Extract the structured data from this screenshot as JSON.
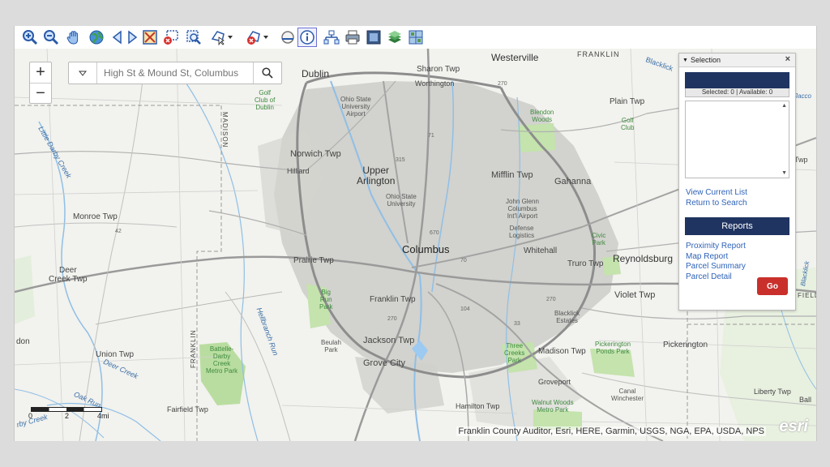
{
  "toolbar": {
    "tools": [
      "zoom-in-icon",
      "zoom-out-icon",
      "pan-icon",
      "full-extent-icon",
      "previous-extent-icon",
      "next-extent-icon",
      "zoom-to-selection-icon",
      "clear-selection-icon",
      "zoom-box-icon",
      "select-dropdown-icon",
      "clear-graphics-dropdown-icon",
      "measure-icon",
      "identify-icon",
      "print-layout-icon",
      "print-icon",
      "overview-icon",
      "layers-icon",
      "basemap-icon"
    ],
    "active_tool": "identify-icon"
  },
  "map": {
    "zoom_in": "+",
    "zoom_out": "−",
    "search_value": "",
    "search_placeholder": "High St & Mound St, Columbus",
    "attribution": "Franklin County Auditor, Esri, HERE, Garmin, USGS, NGA, EPA, USDA, NPS",
    "esri_logo": "esri",
    "scale": {
      "l0": "0",
      "l1": "2",
      "l2": "4mi"
    },
    "labels": {
      "westerville": "Westerville",
      "franklin_n": "FRANKLIN",
      "blacklick_n": "Blacklick",
      "sharon": "Sharon Twp",
      "worthington": "Worthington",
      "dublin": "Dublin",
      "osu_airport": "Ohio State\nUniversity\nAirport",
      "golf_dublin": "Golf\nClub of\nDublin",
      "blendon": "Blendon\nWoods",
      "plain": "Plain Twp",
      "golf_club": "Golf\nClub",
      "norwich": "Norwich Twp",
      "hilliard": "Hilliard",
      "upper_arlington": "Upper\nArlington",
      "mifflin": "Mifflin Twp",
      "gahanna": "Gahanna",
      "osu": "Ohio State\nUniversity",
      "jglenn": "John Glenn\nColumbus\nInt'l Airport",
      "defense": "Defense\nLogistics",
      "monroe": "Monroe Twp",
      "deer_creek": "Deer\nCreek Twp",
      "prairie": "Prairie Twp",
      "columbus": "Columbus",
      "whitehall": "Whitehall",
      "truro": "Truro Twp",
      "reynoldsburg": "Reynoldsburg",
      "civic_park": "Civic\nPark",
      "big_run": "Big\nRun\nPark",
      "franklin_twp": "Franklin Twp",
      "violet": "Violet Twp",
      "blacklick_estates": "Blacklick\nEstates",
      "beulah": "Beulah\nPark",
      "jackson": "Jackson Twp",
      "three_creeks": "Three\nCreeks\nPark",
      "madison": "Madison Twp",
      "pickerington_ponds": "Pickerington\nPonds Park",
      "pickerington": "Pickerington",
      "union": "Union Twp",
      "battelle": "Battelle-\nDarby\nCreek\nMetro Park",
      "grove_city": "Grove City",
      "groveport": "Groveport",
      "canal_winchester": "Canal\nWinchester",
      "walnut_woods": "Walnut Woods\nMetro Park",
      "liberty": "Liberty Twp",
      "hamilton": "Hamilton Twp",
      "fairfield": "Fairfield Twp",
      "franklin_w": "FRANKLIN",
      "madison_w": "MADISON",
      "fairfield_e": "FIELD",
      "little_darby": "Little Darby Creek",
      "hellbranch": "Hellbranch Run",
      "deer_creek_w": "Deer Creek",
      "oak_run": "Oak Run",
      "darby_creek": "rby Creek",
      "don": "don",
      "twp_e": "Twp",
      "ball": "Ball",
      "blacklick_e": "Blacklick",
      "jaco": "Jacco",
      "r_42": "42",
      "r_270a": "270",
      "r_270b": "270",
      "r_270c": "270",
      "r_71": "71",
      "r_315": "315",
      "r_670": "670",
      "r_70": "70",
      "r_104": "104",
      "r_33": "33"
    }
  },
  "panel": {
    "title": "Selection",
    "close": "×",
    "counts": "Selected: 0 | Available: 0",
    "links": [
      "View Current List",
      "Return to Search"
    ],
    "reports_label": "Reports",
    "report_links": [
      "Proximity Report",
      "Map Report",
      "Parcel Summary",
      "Parcel Detail"
    ],
    "go_label": "Go"
  }
}
